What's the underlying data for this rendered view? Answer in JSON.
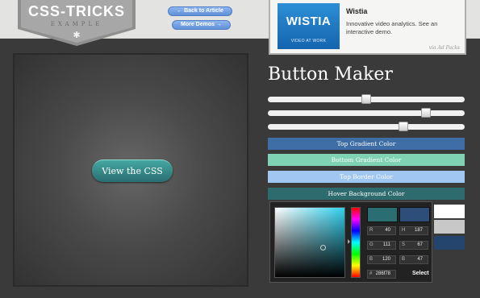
{
  "logo": {
    "title": "CSS-TRICKS",
    "subtitle": "EXAMPLE",
    "ornament": "✱"
  },
  "nav": {
    "back_label": "← Back to Article",
    "more_label": "More Demos →"
  },
  "ad": {
    "logo_text": "WISTIA",
    "logo_caption": "VIDEO AT WORK",
    "name": "Wistia",
    "description": "Innovative video analytics. See an interactive demo.",
    "via": "via Ad Packs"
  },
  "demo": {
    "button_label": "View the CSS"
  },
  "maker": {
    "title": "Button Maker",
    "sliders": [
      {
        "name": "slider-1",
        "value": 0.5
      },
      {
        "name": "slider-2",
        "value": 0.82
      },
      {
        "name": "slider-3",
        "value": 0.7
      }
    ],
    "color_bars": [
      {
        "label": "Top Gradient Color",
        "color": "#3f6ea6"
      },
      {
        "label": "Bottom Gradient Color",
        "color": "#7fd3b4"
      },
      {
        "label": "Top Border Color",
        "color": "#9fc7f2"
      },
      {
        "label": "Hover Background Color",
        "color": "#2e6b6e"
      }
    ],
    "swatches": [
      "#ffffff",
      "#c8c8c8",
      "#24456e"
    ]
  },
  "picker": {
    "r_label": "R",
    "r": "40",
    "g_label": "G",
    "g": "111",
    "b_label": "B",
    "b": "120",
    "h_label": "H",
    "h": "187",
    "s_label": "S",
    "s": "67",
    "v_label": "B",
    "v": "47",
    "hex_label": "#",
    "hex": "286f78",
    "select_label": "Select"
  }
}
